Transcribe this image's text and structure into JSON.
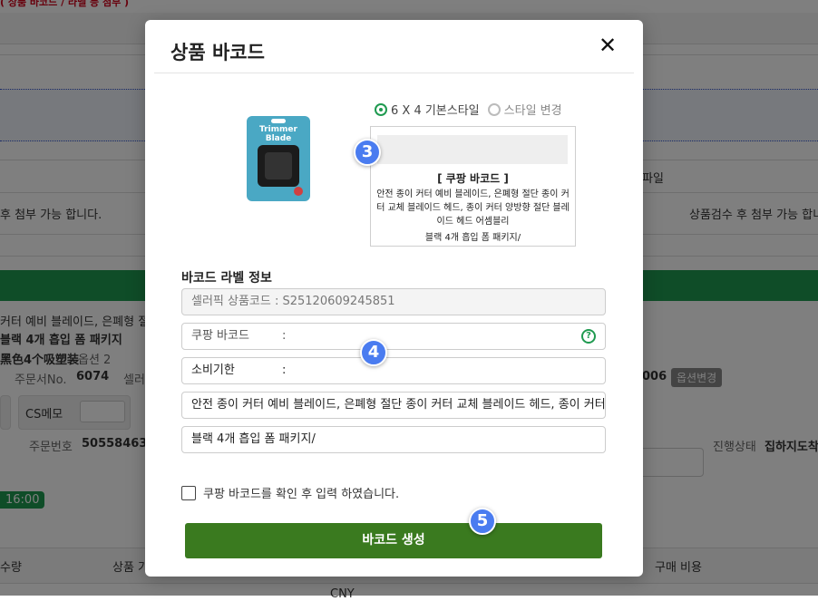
{
  "background": {
    "top_note": "( 상품 바코드 / 라벨 등 첨부 )",
    "attach_note_left": "후 첨부 가능 합니다.",
    "attach_note_right": "상품검수 후 첨부 가능 합니",
    "file_label": "파일",
    "product_line1": "커터 예비 블레이드, 은폐형 절단",
    "product_line2": "블랙 4개 흡입 폼 패키지",
    "chinese_option": "黑色4个吸塑装",
    "option_label": "옵션 2",
    "order_no_label": "주문서No.",
    "order_no_value": "6074",
    "seller_label": "셀러",
    "code_suffix": "006",
    "option_change": "옵션변경",
    "cs_memo": "CS메모",
    "order_number_label": "주문번호",
    "order_number_value": "50558463",
    "progress_label": "진행상태",
    "progress_value": "집하지도착",
    "time_badge": "16:00",
    "col_qty": "수량",
    "col_product": "상품 가",
    "col_purchase_cost": "구매 비용",
    "currency": "CNY"
  },
  "modal": {
    "title": "상품 바코드",
    "close_symbol": "✕",
    "product_image_text": "Trimmer Blade",
    "style_default": "6 X 4 기본스타일",
    "style_change": "스타일 변경",
    "style_selected": "default",
    "preview": {
      "title": "[ 쿠팡 바코드 ]",
      "product_name": "안전 종이 커터 예비 블레이드, 은폐형 절단 종이 커터 교체 블레이드 헤드, 종이 커터 양방향 절단 블레이드 헤드 어셈블리",
      "option": "블랙 4개 흡입 폼 패키지/"
    },
    "section_label": "바코드 라벨 정보",
    "fields": {
      "seller_code": "셀러픽 상품코드 : S25120609245851",
      "coupang_label": "쿠팡 바코드",
      "coupang_value": ":",
      "expiry_label": "소비기한",
      "expiry_value": ":",
      "product_name": "안전 종이 커터 예비 블레이드, 은폐형 절단 종이 커터 교체 블레이드 헤드, 종이 커터",
      "option": "블랙 4개 흡입 폼 패키지/"
    },
    "help_symbol": "?",
    "confirm_text": "쿠팡 바코드를 확인 후 입력 하였습니다.",
    "confirm_checked": false,
    "generate_button": "바코드 생성"
  },
  "steps": {
    "step3": "3",
    "step4": "4",
    "step5": "5"
  },
  "colors": {
    "accent_green": "#1f9a50",
    "button_green": "#3a7a1f",
    "step_blue": "#4a7cf0"
  }
}
